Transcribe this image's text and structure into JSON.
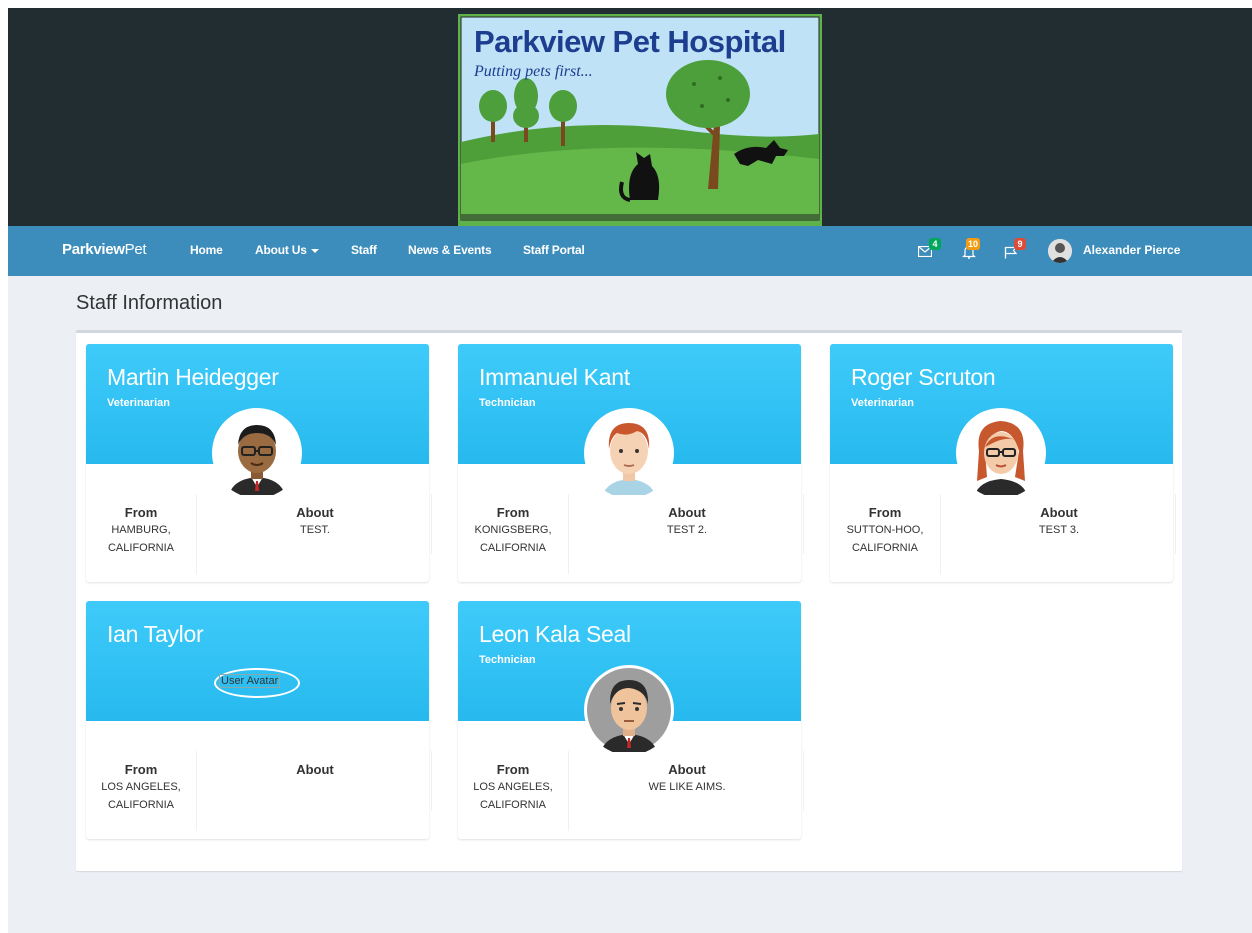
{
  "logo": {
    "title": "Parkview Pet Hospital",
    "tagline": "Putting pets first..."
  },
  "navbar": {
    "brand_bold": "Parkview",
    "brand_light": "Pet",
    "links": [
      "Home",
      "About Us",
      "Staff",
      "News & Events",
      "Staff Portal"
    ],
    "messages_count": "4",
    "notifications_count": "10",
    "tasks_count": "9",
    "user_name": "Alexander Pierce"
  },
  "page": {
    "title": "Staff Information"
  },
  "labels": {
    "from": "From",
    "about": "About",
    "avatar_alt": "User Avatar"
  },
  "staff": [
    {
      "name": "Martin Heidegger",
      "role": "Veterinarian",
      "from": "HAMBURG, CALIFORNIA",
      "about": "TEST."
    },
    {
      "name": "Immanuel Kant",
      "role": "Technician",
      "from": "KONIGSBERG, CALIFORNIA",
      "about": "TEST 2."
    },
    {
      "name": "Roger Scruton",
      "role": "Veterinarian",
      "from": "SUTTON-HOO, CALIFORNIA",
      "about": "TEST 3."
    },
    {
      "name": "Ian Taylor",
      "role": "",
      "from": "LOS ANGELES, CALIFORNIA",
      "about": ""
    },
    {
      "name": "Leon Kala Seal",
      "role": "Technician",
      "from": "LOS ANGELES, CALIFORNIA",
      "about": "WE LIKE AIMS."
    }
  ],
  "colors": {
    "banner": "#222d32",
    "navbar": "#3c8dbc",
    "card_header": "#36c2f5",
    "background": "#ecf0f5",
    "badge_green": "#00a65a",
    "badge_yellow": "#f39c12",
    "badge_red": "#dd4b39"
  }
}
